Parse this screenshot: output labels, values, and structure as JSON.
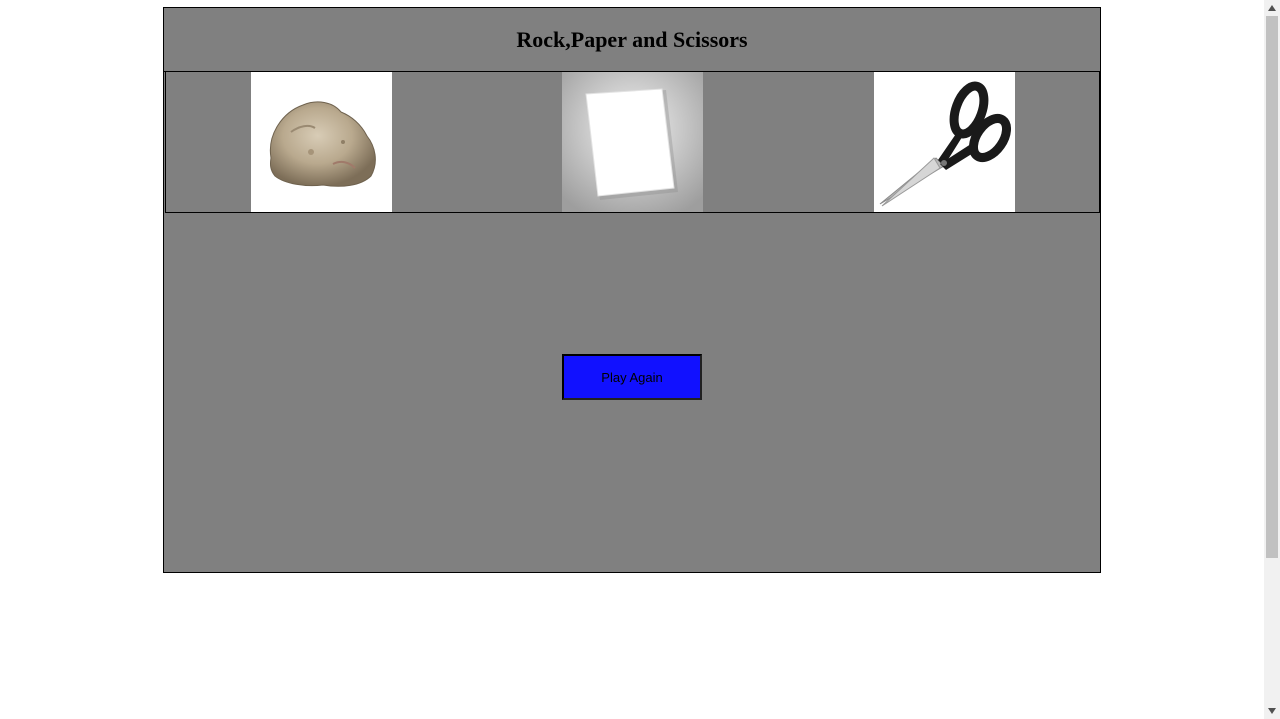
{
  "page": {
    "title": "Rock,Paper and Scissors"
  },
  "choices": [
    {
      "name": "rock",
      "icon": "rock-icon"
    },
    {
      "name": "paper",
      "icon": "paper-icon"
    },
    {
      "name": "scissors",
      "icon": "scissors-icon"
    }
  ],
  "play_again_label": "Play Again",
  "colors": {
    "panel": "#808080",
    "button": "#1111ff",
    "page_background": "#ffffff"
  }
}
